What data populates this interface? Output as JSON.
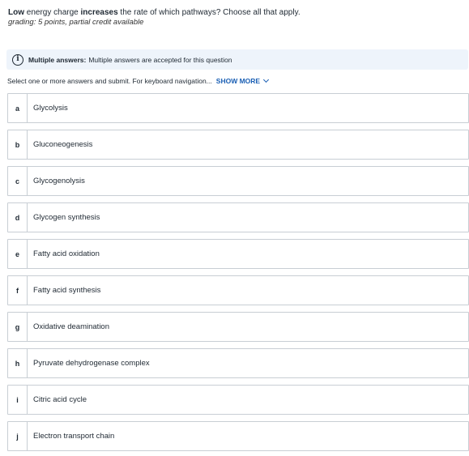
{
  "question": {
    "part1_bold": "Low",
    "part2": " energy charge ",
    "part3_bold": "increases",
    "part4": " the rate of which pathways? Choose all that apply."
  },
  "grading": "grading: 5 points, partial credit available",
  "info_banner": {
    "icon": "info-icon",
    "label": "Multiple answers:",
    "text": "Multiple answers are accepted for this question"
  },
  "instructions": {
    "text": "Select one or more answers and submit. For keyboard navigation...",
    "show_more": "SHOW MORE"
  },
  "options": [
    {
      "letter": "a",
      "text": "Glycolysis"
    },
    {
      "letter": "b",
      "text": "Gluconeogenesis"
    },
    {
      "letter": "c",
      "text": "Glycogenolysis"
    },
    {
      "letter": "d",
      "text": "Glycogen synthesis"
    },
    {
      "letter": "e",
      "text": "Fatty acid oxidation"
    },
    {
      "letter": "f",
      "text": "Fatty acid synthesis"
    },
    {
      "letter": "g",
      "text": "Oxidative deamination"
    },
    {
      "letter": "h",
      "text": "Pyruvate dehydrogenase complex"
    },
    {
      "letter": "i",
      "text": "Citric acid cycle"
    },
    {
      "letter": "j",
      "text": "Electron transport chain"
    }
  ],
  "colors": {
    "accent": "#1a5fb4",
    "banner_bg": "#eef4fb",
    "border": "#c8ced4"
  }
}
